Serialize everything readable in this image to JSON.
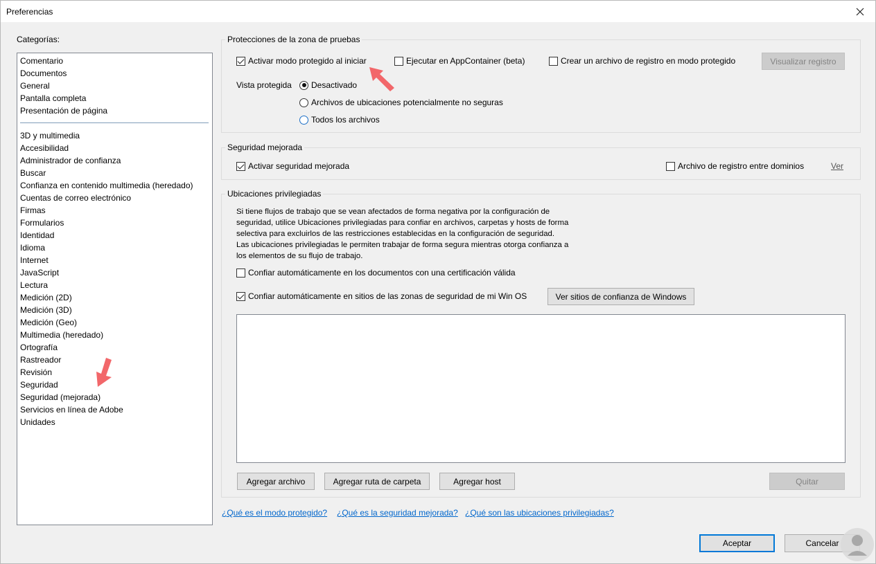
{
  "window": {
    "title": "Preferencias"
  },
  "categories": {
    "label": "Categorías:",
    "top_items": [
      "Comentario",
      "Documentos",
      "General",
      "Pantalla completa",
      "Presentación de página"
    ],
    "items": [
      "3D y multimedia",
      "Accesibilidad",
      "Administrador de confianza",
      "Buscar",
      "Confianza en contenido multimedia (heredado)",
      "Cuentas de correo electrónico",
      "Firmas",
      "Formularios",
      "Identidad",
      "Idioma",
      "Internet",
      "JavaScript",
      "Lectura",
      "Medición (2D)",
      "Medición (3D)",
      "Medición (Geo)",
      "Multimedia (heredado)",
      "Ortografía",
      "Rastreador",
      "Revisión",
      "Seguridad",
      "Seguridad (mejorada)",
      "Servicios en línea de Adobe",
      "Unidades"
    ]
  },
  "sandbox": {
    "title": "Protecciones de la zona de pruebas",
    "protected_mode": {
      "label": "Activar modo protegido al iniciar",
      "checked": true
    },
    "appcontainer": {
      "label": "Ejecutar en AppContainer (beta)",
      "checked": false
    },
    "log_file": {
      "label": "Crear un archivo de registro en modo protegido",
      "checked": false
    },
    "view_log_button": "Visualizar registro",
    "protected_view_label": "Vista protegida",
    "radios": [
      {
        "label": "Desactivado",
        "selected": true
      },
      {
        "label": "Archivos de ubicaciones potencialmente no seguras",
        "selected": false
      },
      {
        "label": "Todos los archivos",
        "selected": false
      }
    ]
  },
  "enhanced": {
    "title": "Seguridad mejorada",
    "enable": {
      "label": "Activar seguridad mejorada",
      "checked": true
    },
    "cross_domain": {
      "label": "Archivo de registro entre dominios",
      "checked": false
    },
    "view_link": "Ver"
  },
  "privileged": {
    "title": "Ubicaciones privilegiadas",
    "description": "Si tiene flujos de trabajo que se vean afectados de forma negativa por la configuración de seguridad, utilice Ubicaciones privilegiadas para confiar en archivos, carpetas y hosts de forma selectiva para excluirlos de las restricciones establecidas en la configuración de seguridad. Las ubicaciones privilegiadas le permiten trabajar de forma segura mientras otorga confianza a los elementos de su flujo de trabajo.",
    "trust_certified": {
      "label": "Confiar automáticamente en los documentos con una certificación válida",
      "checked": false
    },
    "trust_os_zones": {
      "label": "Confiar automáticamente en sitios de las zonas de seguridad de mi Win OS",
      "checked": true
    },
    "view_windows_sites_button": "Ver sitios de confianza de Windows",
    "add_file_button": "Agregar archivo",
    "add_folder_button": "Agregar ruta de carpeta",
    "add_host_button": "Agregar host",
    "remove_button": "Quitar"
  },
  "help_links": [
    "¿Qué es el modo protegido?",
    "¿Qué es la seguridad mejorada?",
    "¿Qué son las ubicaciones privilegiadas?"
  ],
  "footer": {
    "ok_button": "Aceptar",
    "cancel_button": "Cancelar"
  },
  "colors": {
    "link": "#0066cc",
    "annotation_arrow": "#f2676a",
    "default_button_border": "#0078d7"
  }
}
